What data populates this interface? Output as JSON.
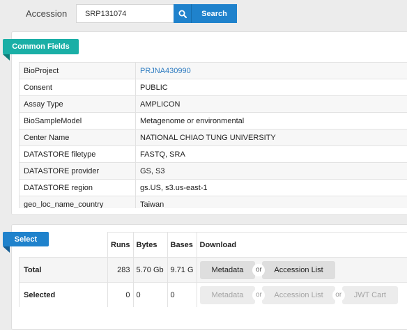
{
  "accession": {
    "label": "Accession",
    "value": "SRP131074",
    "search_icon": "search-icon",
    "search_label": "Search"
  },
  "common": {
    "title": "Common Fields",
    "fields": [
      {
        "key": "BioProject",
        "value": "PRJNA430990",
        "link": true
      },
      {
        "key": "Consent",
        "value": "PUBLIC"
      },
      {
        "key": "Assay Type",
        "value": "AMPLICON"
      },
      {
        "key": "BioSampleModel",
        "value": "Metagenome or environmental"
      },
      {
        "key": "Center Name",
        "value": "NATIONAL CHIAO TUNG UNIVERSITY"
      },
      {
        "key": "DATASTORE filetype",
        "value": "FASTQ, SRA"
      },
      {
        "key": "DATASTORE provider",
        "value": "GS, S3"
      },
      {
        "key": "DATASTORE region",
        "value": "gs.US, s3.us-east-1"
      },
      {
        "key": "geo_loc_name_country",
        "value": "Taiwan"
      }
    ]
  },
  "select": {
    "title": "Select",
    "headers": {
      "runs": "Runs",
      "bytes": "Bytes",
      "bases": "Bases",
      "download": "Download"
    },
    "total": {
      "label": "Total",
      "runs": "283",
      "bytes": "5.70 Gb",
      "bases": "9.71 G",
      "metadata": "Metadata",
      "or": "or",
      "accession_list": "Accession List"
    },
    "selected": {
      "label": "Selected",
      "runs": "0",
      "bytes": "0",
      "bases": "0",
      "metadata": "Metadata",
      "or1": "or",
      "accession_list": "Accession List",
      "or2": "or",
      "jwt_cart": "JWT Cart"
    }
  },
  "colors": {
    "primary_blue": "#1f82cc",
    "teal": "#1aafa6",
    "link": "#2d7bc0"
  }
}
